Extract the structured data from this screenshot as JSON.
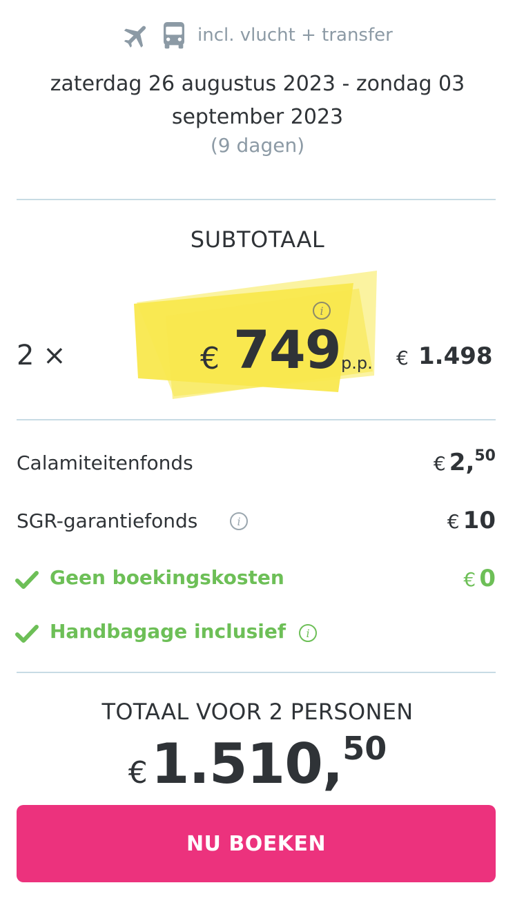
{
  "header": {
    "incl_text": "incl. vlucht + transfer",
    "icons": [
      "plane-icon",
      "bus-icon"
    ],
    "dates": "zaterdag 26 augustus 2023 - zondag 03 september 2023",
    "duration": "(9 dagen)"
  },
  "subtotal": {
    "title": "SUBTOTAAL",
    "multiplier": "2 ×",
    "pp_currency": "€",
    "pp_price": "749",
    "pp_label": "p.p.",
    "sum_currency": "€",
    "sum_amount": "1.498"
  },
  "lines": [
    {
      "label": "Calamiteitenfonds",
      "currency": "€",
      "value": "2,",
      "sup": "50"
    },
    {
      "label": "SGR-garantiefonds",
      "currency": "€",
      "value": "10",
      "sup": ""
    },
    {
      "label": "Geen boekingskosten",
      "currency": "€",
      "value": "0",
      "sup": ""
    },
    {
      "label": "Handbagage inclusief"
    }
  ],
  "total": {
    "title": "TOTAAL VOOR 2 PERSONEN",
    "currency": "€",
    "value": "1.510,",
    "sup": "50"
  },
  "button": {
    "label": "NU BOEKEN"
  },
  "colors": {
    "text": "#2f3337",
    "muted": "#8c9aa5",
    "divider": "#c7dbe4",
    "highlight": "#f9e84e",
    "green": "#6dbf57",
    "button": "#ec327d"
  }
}
